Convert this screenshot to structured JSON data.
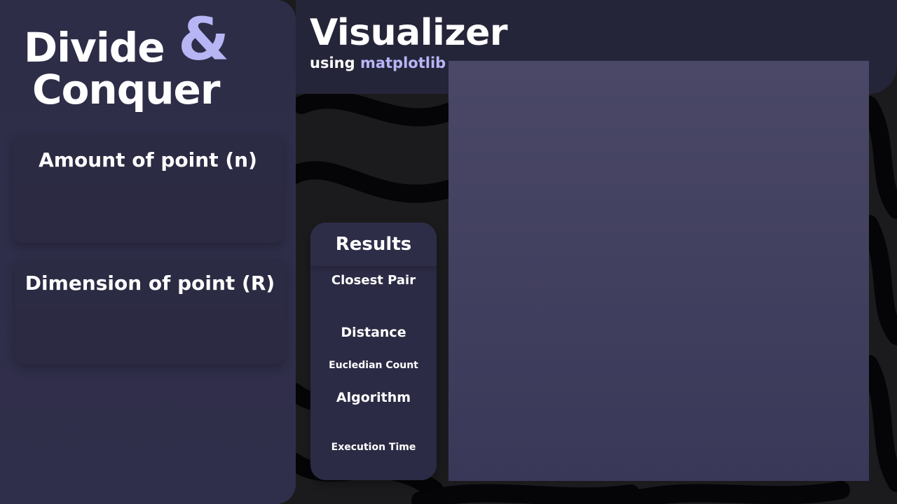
{
  "app": {
    "title_line1": "Divide",
    "title_amp": "&",
    "title_line2": "Conquer"
  },
  "inputs": {
    "amount": {
      "label": "Amount of point (n)",
      "value": "",
      "placeholder": ""
    },
    "dimension": {
      "label": "Dimension of point (R)",
      "value": "",
      "placeholder": ""
    }
  },
  "header": {
    "title": "Visualizer",
    "subtitle_prefix": "using",
    "subtitle_accent": "matplotlib"
  },
  "results": {
    "title": "Results",
    "closest_pair": "Closest Pair",
    "distance": "Distance",
    "euclidean_count": "Eucledian Count",
    "algorithm": "Algorithm",
    "execution_time": "Execution Time"
  },
  "colors": {
    "accent": "#b8b5f5",
    "panel": "#2e2d48",
    "plot": "#44425f",
    "background": "#1b1b1e"
  }
}
